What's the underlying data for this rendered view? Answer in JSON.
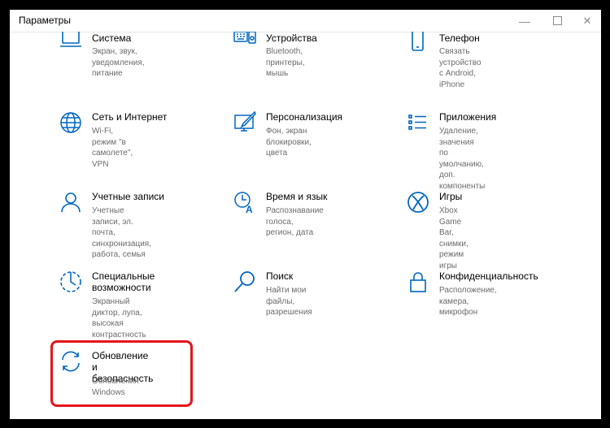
{
  "window": {
    "title": "Параметры",
    "minimize_icon": "minimize-icon",
    "maximize_icon": "maximize-icon",
    "close_icon": "close-icon"
  },
  "accent": "#0067c0",
  "highlight_color": "#e5141c",
  "tiles": [
    {
      "name": "Система",
      "desc": "Экран, звук, уведомления,\nпитание",
      "icon": "laptop-icon"
    },
    {
      "name": "Устройства",
      "desc": "Bluetooth, принтеры, мышь",
      "icon": "keyboard-icon"
    },
    {
      "name": "Телефон",
      "desc": "Связать устройство с Android,\niPhone",
      "icon": "phone-icon"
    },
    {
      "name": "Сеть и Интернет",
      "desc": "Wi-Fi, режим \"в самолете\",\nVPN",
      "icon": "globe-icon"
    },
    {
      "name": "Персонализация",
      "desc": "Фон, экран блокировки, цвета",
      "icon": "paint-icon"
    },
    {
      "name": "Приложения",
      "desc": "Удаление, значения по\nумолчанию, доп. компоненты",
      "icon": "apps-list-icon"
    },
    {
      "name": "Учетные записи",
      "desc": "Учетные записи, эл. почта,\nсинхронизация, работа, семья",
      "icon": "person-icon"
    },
    {
      "name": "Время и язык",
      "desc": "Распознавание голоса,\nрегион, дата",
      "icon": "time-language-icon"
    },
    {
      "name": "Игры",
      "desc": "Xbox Game Bar, снимки,\nрежим игры",
      "icon": "xbox-icon"
    },
    {
      "name": "Специальные\nвозможности",
      "desc": "Экранный диктор, лупа,\nвысокая контрастность",
      "icon": "accessibility-icon"
    },
    {
      "name": "Поиск",
      "desc": "Найти мои файлы,\nразрешения",
      "icon": "search-icon"
    },
    {
      "name": "Конфиденциальность",
      "desc": "Расположение, камера,\nмикрофон",
      "icon": "lock-icon"
    },
    {
      "name": "Обновление и\nбезопасность",
      "desc": "Обновления Windows",
      "icon": "update-icon"
    }
  ]
}
